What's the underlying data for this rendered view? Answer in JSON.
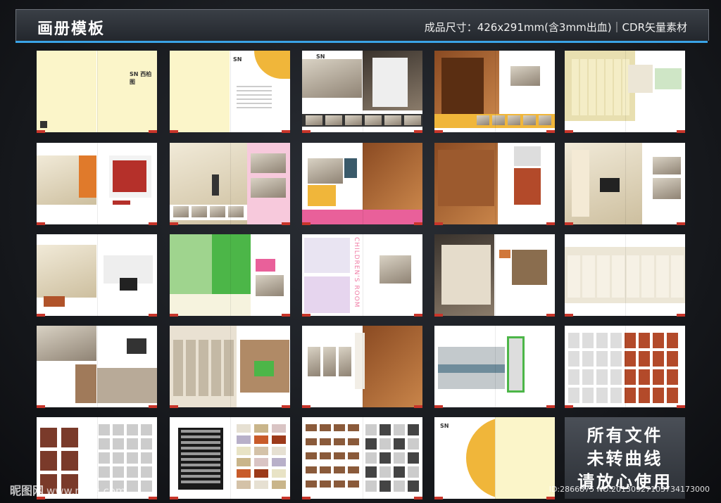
{
  "header": {
    "title": "画册模板",
    "spec": "成品尺寸：426x291mm(含3mm出血)｜CDR矢量素材"
  },
  "thumbnails": [
    {
      "name": "cover",
      "theme": "cream"
    },
    {
      "name": "intro-page",
      "theme": "cream-white"
    },
    {
      "name": "wardrobe-white",
      "theme": "photo"
    },
    {
      "name": "wood-cabinet-yellow",
      "theme": "photo-yellow"
    },
    {
      "name": "panel-doors",
      "theme": "photo-cream"
    },
    {
      "name": "orange-bedroom",
      "theme": "photo"
    },
    {
      "name": "study-room",
      "theme": "photo-pink"
    },
    {
      "name": "bookshelf-pink",
      "theme": "photo-pink"
    },
    {
      "name": "wine-cabinet",
      "theme": "photo"
    },
    {
      "name": "tv-wall",
      "theme": "photo"
    },
    {
      "name": "living-wall-unit",
      "theme": "photo"
    },
    {
      "name": "kids-room-green",
      "theme": "photo-green"
    },
    {
      "name": "children-room",
      "theme": "photo-pink"
    },
    {
      "name": "dark-wardrobe",
      "theme": "photo"
    },
    {
      "name": "corner-closet",
      "theme": "photo"
    },
    {
      "name": "walk-in-closet",
      "theme": "photo"
    },
    {
      "name": "clothes-storage",
      "theme": "photo-green"
    },
    {
      "name": "wood-sliding-doors",
      "theme": "photo"
    },
    {
      "name": "glass-doors",
      "theme": "photo-green"
    },
    {
      "name": "door-samples",
      "theme": "catalog"
    },
    {
      "name": "door-catalog",
      "theme": "catalog"
    },
    {
      "name": "color-swatches",
      "theme": "catalog"
    },
    {
      "name": "material-swatches",
      "theme": "catalog"
    },
    {
      "name": "back-cover",
      "theme": "cream"
    }
  ],
  "labels": {
    "brand": "SN",
    "brand_cn": "西柏图",
    "children_room": "CHILDREN'S ROOM"
  },
  "promo": {
    "line1": "所有文件",
    "line2": "未转曲线",
    "line3": "请放心使用"
  },
  "watermark": {
    "site_cn": "昵图网",
    "site_url": "www.nipic.com",
    "id_text": "ID:2866875 NO:20130927103734173000"
  },
  "colors": {
    "accent_blue": "#3aa3e6",
    "cream": "#fbf5c9",
    "orange": "#f0b63a",
    "pink": "#e9609a",
    "green": "#4cb648"
  }
}
